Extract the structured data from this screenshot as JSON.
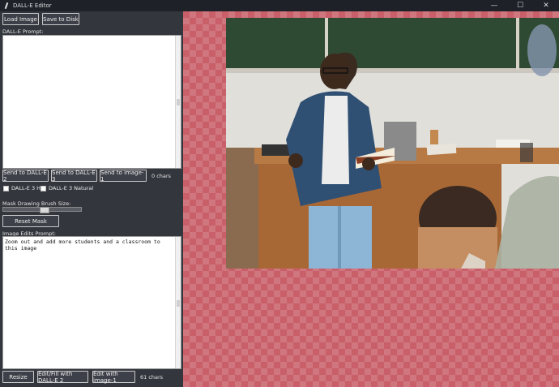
{
  "window": {
    "title": "DALL-E Editor"
  },
  "toolbar": {
    "load_label": "Load Image",
    "save_label": "Save to Disk"
  },
  "dalle_prompt": {
    "label": "DALL-E Prompt:",
    "value": ""
  },
  "send_buttons": {
    "dalle2": "Send to DALL-E 2",
    "dalle3": "Send to DALL-E 3",
    "image1": "Send to image-1",
    "chars": "0 chars"
  },
  "options": {
    "hd_label": "DALL-E 3 HD",
    "natural_label": "DALL-E 3 Natural",
    "hd_checked": false,
    "natural_checked": false
  },
  "mask": {
    "label": "Mask Drawing Brush Size:",
    "brush_level": 0.5,
    "reset_label": "Reset Mask"
  },
  "edit_prompt": {
    "label": "Image Edits Prompt:",
    "value": "Zoom out and add more students and a classroom to this image"
  },
  "bottom": {
    "resize_label": "Resize",
    "edit_fill_label": "Edit/Fill with DALL-E 2",
    "edit_image1_label": "Edit with image-1",
    "chars": "61 chars"
  },
  "colors": {
    "panel_bg": "#33363d",
    "titlebar_bg": "#1e2128",
    "mask_checker": "#c85f69"
  }
}
